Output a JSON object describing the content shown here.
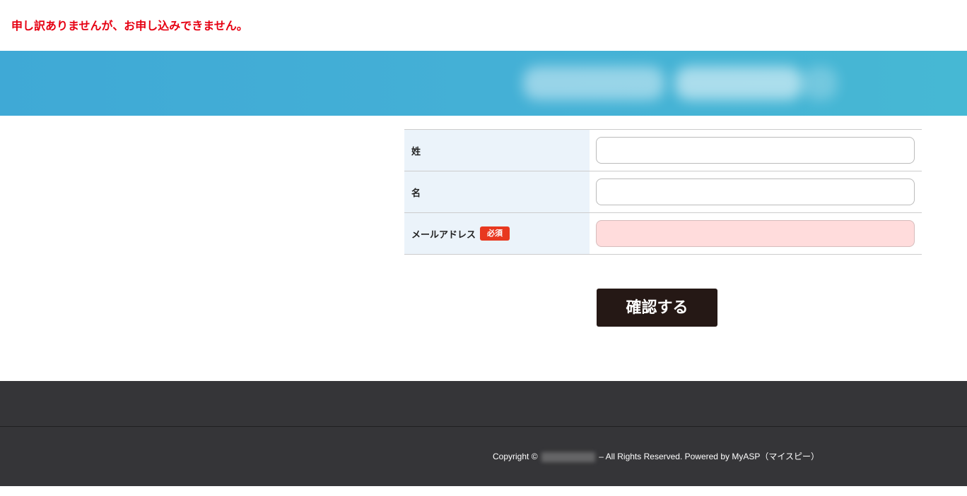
{
  "error_message": "申し訳ありませんが、お申し込みできません。",
  "form": {
    "fields": [
      {
        "label": "姓",
        "value": "",
        "required": false
      },
      {
        "label": "名",
        "value": "",
        "required": false
      },
      {
        "label": "メールアドレス",
        "value": "",
        "required": true,
        "required_label": "必須"
      }
    ],
    "confirm_label": "確認する"
  },
  "footer": {
    "copyright_prefix": "Copyright ©",
    "copyright_suffix": "– All Rights Reserved. Powered by MyASP（マイスピー）"
  },
  "colors": {
    "error_text": "#e60012",
    "banner": "#44b0d6",
    "label_bg": "#ebf3fa",
    "required_badge": "#e8381f",
    "error_field_bg": "#ffdcdc",
    "confirm_button": "#251815",
    "footer_bg": "#353538"
  }
}
